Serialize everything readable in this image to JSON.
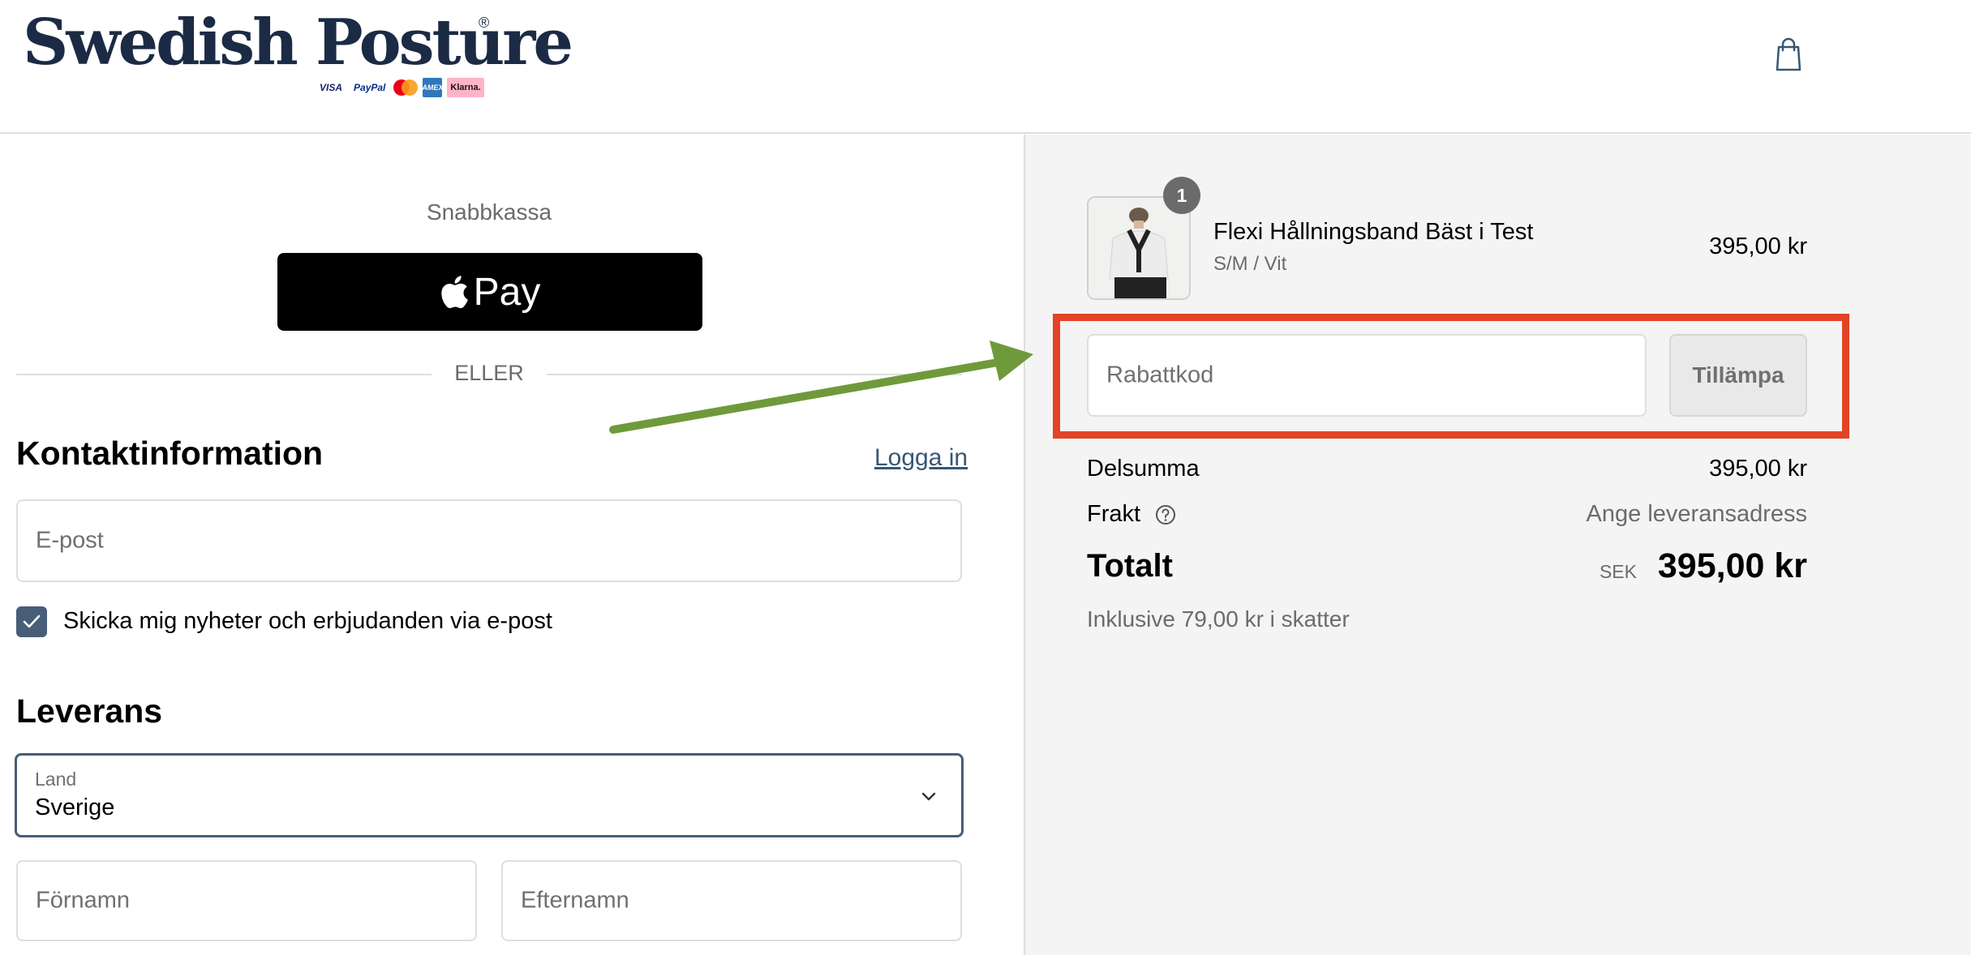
{
  "header": {
    "logo_text": "Swedish Posture",
    "logo_registered": "®",
    "payment_methods": [
      {
        "name": "VISA",
        "icon": "visa-logo"
      },
      {
        "name": "PayPal",
        "icon": "paypal-logo"
      },
      {
        "name": "Mastercard",
        "icon": "mastercard-logo"
      },
      {
        "name": "AMEX",
        "icon": "amex-logo"
      },
      {
        "name": "Klarna.",
        "icon": "klarna-logo"
      }
    ],
    "cart_icon": "shopping-bag-icon"
  },
  "express": {
    "title": "Snabbkassa",
    "apple_pay_label": "Pay",
    "apple_icon": "apple-icon",
    "divider_label": "ELLER"
  },
  "contact": {
    "heading": "Kontaktinformation",
    "login_link": "Logga in",
    "email_placeholder": "E-post",
    "newsletter_label": "Skicka mig nyheter och erbjudanden via e-post",
    "newsletter_checked": true
  },
  "delivery": {
    "heading": "Leverans",
    "country_label": "Land",
    "country_value": "Sverige",
    "first_name_placeholder": "Förnamn",
    "last_name_placeholder": "Efternamn"
  },
  "order": {
    "item": {
      "quantity": "1",
      "title": "Flexi Hållningsband Bäst i Test",
      "variant": "S/M / Vit",
      "price": "395,00 kr"
    },
    "discount_placeholder": "Rabattkod",
    "apply_label": "Tillämpa",
    "subtotal_label": "Delsumma",
    "subtotal_value": "395,00 kr",
    "shipping_label": "Frakt",
    "shipping_value": "Ange leveransadress",
    "total_label": "Totalt",
    "total_currency": "SEK",
    "total_value": "395,00 kr",
    "tax_note": "Inklusive 79,00 kr i skatter"
  },
  "annotation": {
    "highlight_color": "#e34327",
    "arrow_color": "#6f9a3b"
  }
}
